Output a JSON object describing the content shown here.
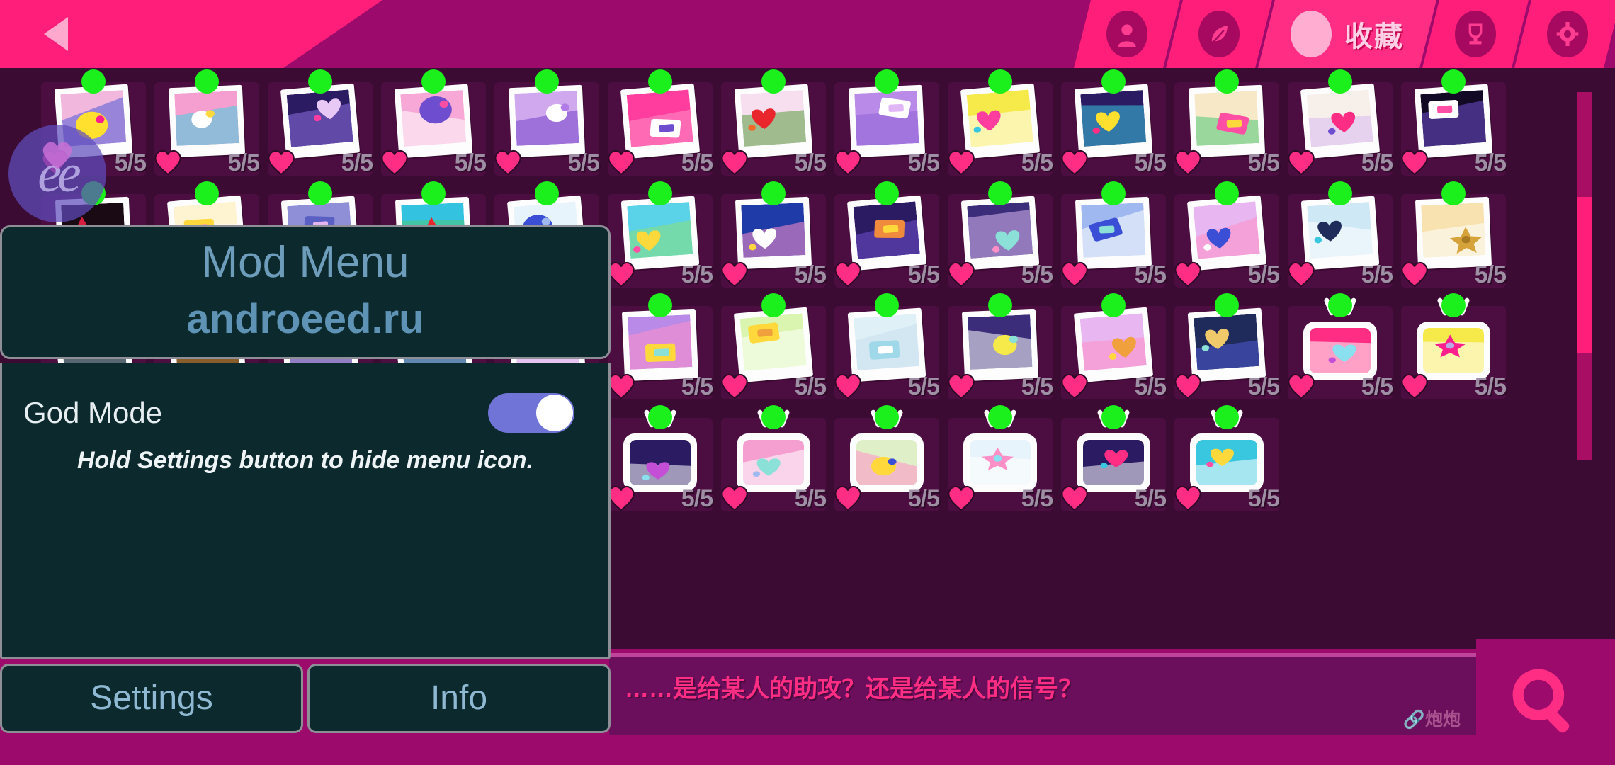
{
  "topbar": {
    "back_icon": "back-triangle-icon",
    "nav": [
      {
        "id": "profile",
        "icon": "person-icon",
        "label": "",
        "active": false
      },
      {
        "id": "feather",
        "icon": "leaf-icon",
        "label": "",
        "active": false
      },
      {
        "id": "collection",
        "icon": "star-icon",
        "label": "收藏",
        "active": true
      },
      {
        "id": "trophy",
        "icon": "trophy-icon",
        "label": "",
        "active": false
      },
      {
        "id": "settings",
        "icon": "gear-icon",
        "label": "",
        "active": false
      }
    ]
  },
  "grid": {
    "columns": 13,
    "rows": 5,
    "count_label": "5/5",
    "heart_icon": "heart-icon",
    "status_dot": "green-dot-icon",
    "cards": [
      {
        "shape": "polaroid",
        "count": "5/5",
        "art": "heart-sparkle",
        "bg": "#f2b7dd",
        "c1": "#ffe02e",
        "c2": "#ff1e8e",
        "c3": "#4f5bd5"
      },
      {
        "shape": "polaroid",
        "count": "5/5",
        "art": "bone-ribbon",
        "bg": "#f49fd0",
        "c1": "#ffffff",
        "c2": "#ffd93b",
        "c3": "#41d0e0"
      },
      {
        "shape": "polaroid",
        "count": "5/5",
        "art": "music-chat",
        "bg": "#2b1b63",
        "c1": "#e8c8f5",
        "c2": "#ff3da0",
        "c3": "#8e6fe0"
      },
      {
        "shape": "polaroid",
        "count": "5/5",
        "art": "triangle-fold",
        "bg": "#f7a8d6",
        "c1": "#6e4ecf",
        "c2": "#ff4fa4",
        "c3": "#ffffff"
      },
      {
        "shape": "polaroid",
        "count": "5/5",
        "art": "mouse-window",
        "bg": "#cfa8ee",
        "c1": "#ffffff",
        "c2": "#b17be8",
        "c3": "#7444c9"
      },
      {
        "shape": "polaroid",
        "count": "5/5",
        "art": "cross-spark",
        "bg": "#ff3d9e",
        "c1": "#ffffff",
        "c2": "#6e4ecf",
        "c3": "#ff8fc6"
      },
      {
        "shape": "polaroid",
        "count": "5/5",
        "art": "red-envelope",
        "bg": "#f7dff0",
        "c1": "#e8262c",
        "c2": "#f06a2a",
        "c3": "#5a9c3e"
      },
      {
        "shape": "polaroid",
        "count": "5/5",
        "art": "dove",
        "bg": "#b98ae8",
        "c1": "#ffffff",
        "c2": "#e0b6f5",
        "c3": "#8e62d6"
      },
      {
        "shape": "polaroid",
        "count": "5/5",
        "art": "photo-heart",
        "bg": "#f6e94a",
        "c1": "#ff3d9e",
        "c2": "#39c7e0",
        "c3": "#ffffff"
      },
      {
        "shape": "polaroid",
        "count": "5/5",
        "art": "confetti-burst",
        "bg": "#2b1b63",
        "c1": "#ffe02e",
        "c2": "#ff2d84",
        "c3": "#39c7e0"
      },
      {
        "shape": "polaroid",
        "count": "5/5",
        "art": "sticky-notes",
        "bg": "#f7e9c8",
        "c1": "#ff4fa4",
        "c2": "#ffd93b",
        "c3": "#4fc97a"
      },
      {
        "shape": "polaroid",
        "count": "5/5",
        "art": "bow-arrow",
        "bg": "#f7f0ea",
        "c1": "#ff2d84",
        "c2": "#6e4ecf",
        "c3": "#d9b8f0"
      },
      {
        "shape": "polaroid",
        "count": "5/5",
        "art": "night-sparkle",
        "bg": "#120a24",
        "c1": "#ffffff",
        "c2": "#ff4fa4",
        "c3": "#6e4ecf"
      },
      {
        "shape": "polaroid",
        "count": "5/5",
        "art": "spider-web",
        "bg": "#1a0a14",
        "c1": "#d61f3f",
        "c2": "#ffffff",
        "c3": "#7a1030"
      },
      {
        "shape": "polaroid",
        "count": "5/5",
        "art": "sunburst",
        "bg": "#fff4d1",
        "c1": "#ffd93b",
        "c2": "#ff8fc6",
        "c3": "#ffffff"
      },
      {
        "shape": "polaroid",
        "count": "5/5",
        "art": "portrait-blur",
        "bg": "#8e8fd6",
        "c1": "#5a5fc4",
        "c2": "#e3b6f0",
        "c3": "#ff8fc6"
      },
      {
        "shape": "polaroid",
        "count": "5/5",
        "art": "poster-stripes",
        "bg": "#33c3e0",
        "c1": "#e8262c",
        "c2": "#ffd93b",
        "c3": "#4fc97a"
      },
      {
        "shape": "polaroid",
        "count": "5/5",
        "art": "blue-ribbon",
        "bg": "#e8f4fb",
        "c1": "#3b4fd6",
        "c2": "#9fb8f0",
        "c3": "#ff8fc6"
      },
      {
        "shape": "polaroid",
        "count": "5/5",
        "art": "yellow-star",
        "bg": "#5ad2e8",
        "c1": "#ffd93b",
        "c2": "#ff4fa4",
        "c3": "#8be07a"
      },
      {
        "shape": "polaroid",
        "count": "5/5",
        "art": "rabbit",
        "bg": "#1f3ba8",
        "c1": "#ffffff",
        "c2": "#ffd93b",
        "c3": "#ff8fc6"
      },
      {
        "shape": "polaroid",
        "count": "5/5",
        "art": "owl-mask",
        "bg": "#2b1b63",
        "c1": "#f08a3c",
        "c2": "#ffd93b",
        "c3": "#6e4ecf"
      },
      {
        "shape": "polaroid",
        "count": "5/5",
        "art": "saucer",
        "bg": "#3b2d7a",
        "c1": "#8be0d8",
        "c2": "#ff8fc6",
        "c3": "#d9b8f0"
      },
      {
        "shape": "polaroid",
        "count": "5/5",
        "art": "arcade-box",
        "bg": "#9fb8f0",
        "c1": "#3b4fd6",
        "c2": "#8be0d8",
        "c3": "#ffffff"
      },
      {
        "shape": "polaroid",
        "count": "5/5",
        "art": "blue-star",
        "bg": "#e8b6f0",
        "c1": "#3b4fd6",
        "c2": "#ffffff",
        "c3": "#ff8fc6"
      },
      {
        "shape": "polaroid",
        "count": "5/5",
        "art": "bomb",
        "bg": "#cfe8f5",
        "c1": "#1f2b5a",
        "c2": "#39c7e0",
        "c3": "#ffffff"
      },
      {
        "shape": "polaroid",
        "count": "5/5",
        "art": "gold-bars",
        "bg": "#f7e2b0",
        "c1": "#d6a33b",
        "c2": "#a87a22",
        "c3": "#ffffff"
      },
      {
        "shape": "polaroid",
        "count": "5/5",
        "art": "room-window",
        "bg": "#2f3a42",
        "c1": "#f0c96a",
        "c2": "#fdf0c8",
        "c3": "#7a8a99"
      },
      {
        "shape": "polaroid",
        "count": "5/5",
        "art": "tv-screen",
        "bg": "#0d0d14",
        "c1": "#2b3a8e",
        "c2": "#ff4fa4",
        "c3": "#f0a03c"
      },
      {
        "shape": "polaroid",
        "count": "5/5",
        "art": "planet-bolt",
        "bg": "#2b3a8e",
        "c1": "#8be0d8",
        "c2": "#ffd93b",
        "c3": "#e8b6f0"
      },
      {
        "shape": "polaroid",
        "count": "5/5",
        "art": "star-cloud",
        "bg": "#2b1b63",
        "c1": "#ffffff",
        "c2": "#ff2d84",
        "c3": "#8be0f0"
      },
      {
        "shape": "polaroid",
        "count": "5/5",
        "art": "pink-wave",
        "bg": "#c87ae0",
        "c1": "#ff8fc6",
        "c2": "#8be0d8",
        "c3": "#ffffff"
      },
      {
        "shape": "polaroid",
        "count": "5/5",
        "art": "star-diagonal",
        "bg": "#b98ae8",
        "c1": "#ffd93b",
        "c2": "#8be0d8",
        "c3": "#ff8fc6"
      },
      {
        "shape": "polaroid",
        "count": "5/5",
        "art": "green-star",
        "bg": "#d9f5b0",
        "c1": "#ffd93b",
        "c2": "#f0a03c",
        "c3": "#ffffff"
      },
      {
        "shape": "polaroid",
        "count": "5/5",
        "art": "paper-fold",
        "bg": "#dff0f7",
        "c1": "#9fd8e8",
        "c2": "#ffffff",
        "c3": "#c8e0ee"
      },
      {
        "shape": "polaroid",
        "count": "5/5",
        "art": "star-sparkle",
        "bg": "#3b2d7a",
        "c1": "#f6e94a",
        "c2": "#8be0d8",
        "c3": "#ffffff"
      },
      {
        "shape": "polaroid",
        "count": "5/5",
        "art": "flower-swirl",
        "bg": "#e8b6f0",
        "c1": "#f0a03c",
        "c2": "#ffd93b",
        "c3": "#ff8fc6"
      },
      {
        "shape": "polaroid",
        "count": "5/5",
        "art": "night-window",
        "bg": "#1f2b5a",
        "c1": "#f0c96a",
        "c2": "#8be0d8",
        "c3": "#4f5bd5"
      },
      {
        "shape": "tv",
        "count": "5/5",
        "art": "radar-pink",
        "bg": "#ff2d84",
        "c1": "#8be0f0",
        "c2": "#c44fd6",
        "c3": "#ffffff"
      },
      {
        "shape": "tv",
        "count": "5/5",
        "art": "pink-cushion",
        "bg": "#f6e94a",
        "c1": "#ff1e8e",
        "c2": "#b9a8e8",
        "c3": "#ffffff"
      },
      {
        "shape": "tv",
        "count": "5/5",
        "art": "key-lock",
        "bg": "#f08a9c",
        "c1": "#5a3b7a",
        "c2": "#f0a03c",
        "c3": "#ffd93b"
      },
      {
        "shape": "tv",
        "count": "5/5",
        "art": "blue-burst",
        "bg": "#2b1b63",
        "c1": "#39c7e0",
        "c2": "#ff4fa4",
        "c3": "#ffffff"
      },
      {
        "shape": "tv",
        "count": "5/5",
        "art": "diamond-pink",
        "bg": "#ff8fc6",
        "c1": "#8be0f0",
        "c2": "#ffffff",
        "c3": "#ff2d84"
      },
      {
        "shape": "tv",
        "count": "5/5",
        "art": "purple-zap",
        "bg": "#8be0f0",
        "c1": "#ff2d84",
        "c2": "#6e4ecf",
        "c3": "#ffd93b"
      },
      {
        "shape": "tv",
        "count": "5/5",
        "art": "green-swirl",
        "bg": "#cfe8f5",
        "c1": "#4fc97a",
        "c2": "#b9a8e8",
        "c3": "#ffffff"
      },
      {
        "shape": "tv",
        "count": "5/5",
        "art": "space-dot",
        "bg": "#2b1b63",
        "c1": "#c44fd6",
        "c2": "#8be0f0",
        "c3": "#ffffff"
      },
      {
        "shape": "tv",
        "count": "5/5",
        "art": "music-notes",
        "bg": "#f49fd0",
        "c1": "#8be0d8",
        "c2": "#9fb8f0",
        "c3": "#ffffff"
      },
      {
        "shape": "tv",
        "count": "5/5",
        "art": "star-number-1",
        "bg": "#dff0c8",
        "c1": "#ffd93b",
        "c2": "#3b4fd6",
        "c3": "#ff8fc6"
      },
      {
        "shape": "tv",
        "count": "5/5",
        "art": "no-entry",
        "bg": "#e8f4fb",
        "c1": "#ff8fc6",
        "c2": "#8be0f0",
        "c3": "#ffffff"
      },
      {
        "shape": "tv",
        "count": "5/5",
        "art": "rays-pink",
        "bg": "#2b1b63",
        "c1": "#ff2d84",
        "c2": "#39c7e0",
        "c3": "#ffffff"
      },
      {
        "shape": "tv",
        "count": "5/5",
        "art": "sunburst-blue",
        "bg": "#39c7e0",
        "c1": "#ffd93b",
        "c2": "#ff4fa4",
        "c3": "#ffffff"
      }
    ]
  },
  "scrollbar": {
    "name": "vertical-scrollbar"
  },
  "dialogue": {
    "text": "……是给某人的助攻？还是给某人的信号？",
    "signature": "🔗炮炮"
  },
  "search": {
    "icon": "search-icon"
  },
  "float_icon": {
    "label": "ee"
  },
  "modmenu": {
    "title": "Mod Menu",
    "subtitle": "androeed.ru",
    "rows": [
      {
        "label": "God Mode",
        "toggle_on": true
      }
    ],
    "hint": "Hold Settings button to hide menu icon.",
    "settings_label": "Settings",
    "info_label": "Info"
  },
  "colors": {
    "accent_pink": "#ff1f7a",
    "header_magenta": "#9c0a6b",
    "body_purple": "#3b0b33",
    "slot_purple": "#4c0d41",
    "green_dot": "#1cf01c",
    "panel_dark": "#0c2a2d",
    "panel_text": "#6e9dbc"
  }
}
